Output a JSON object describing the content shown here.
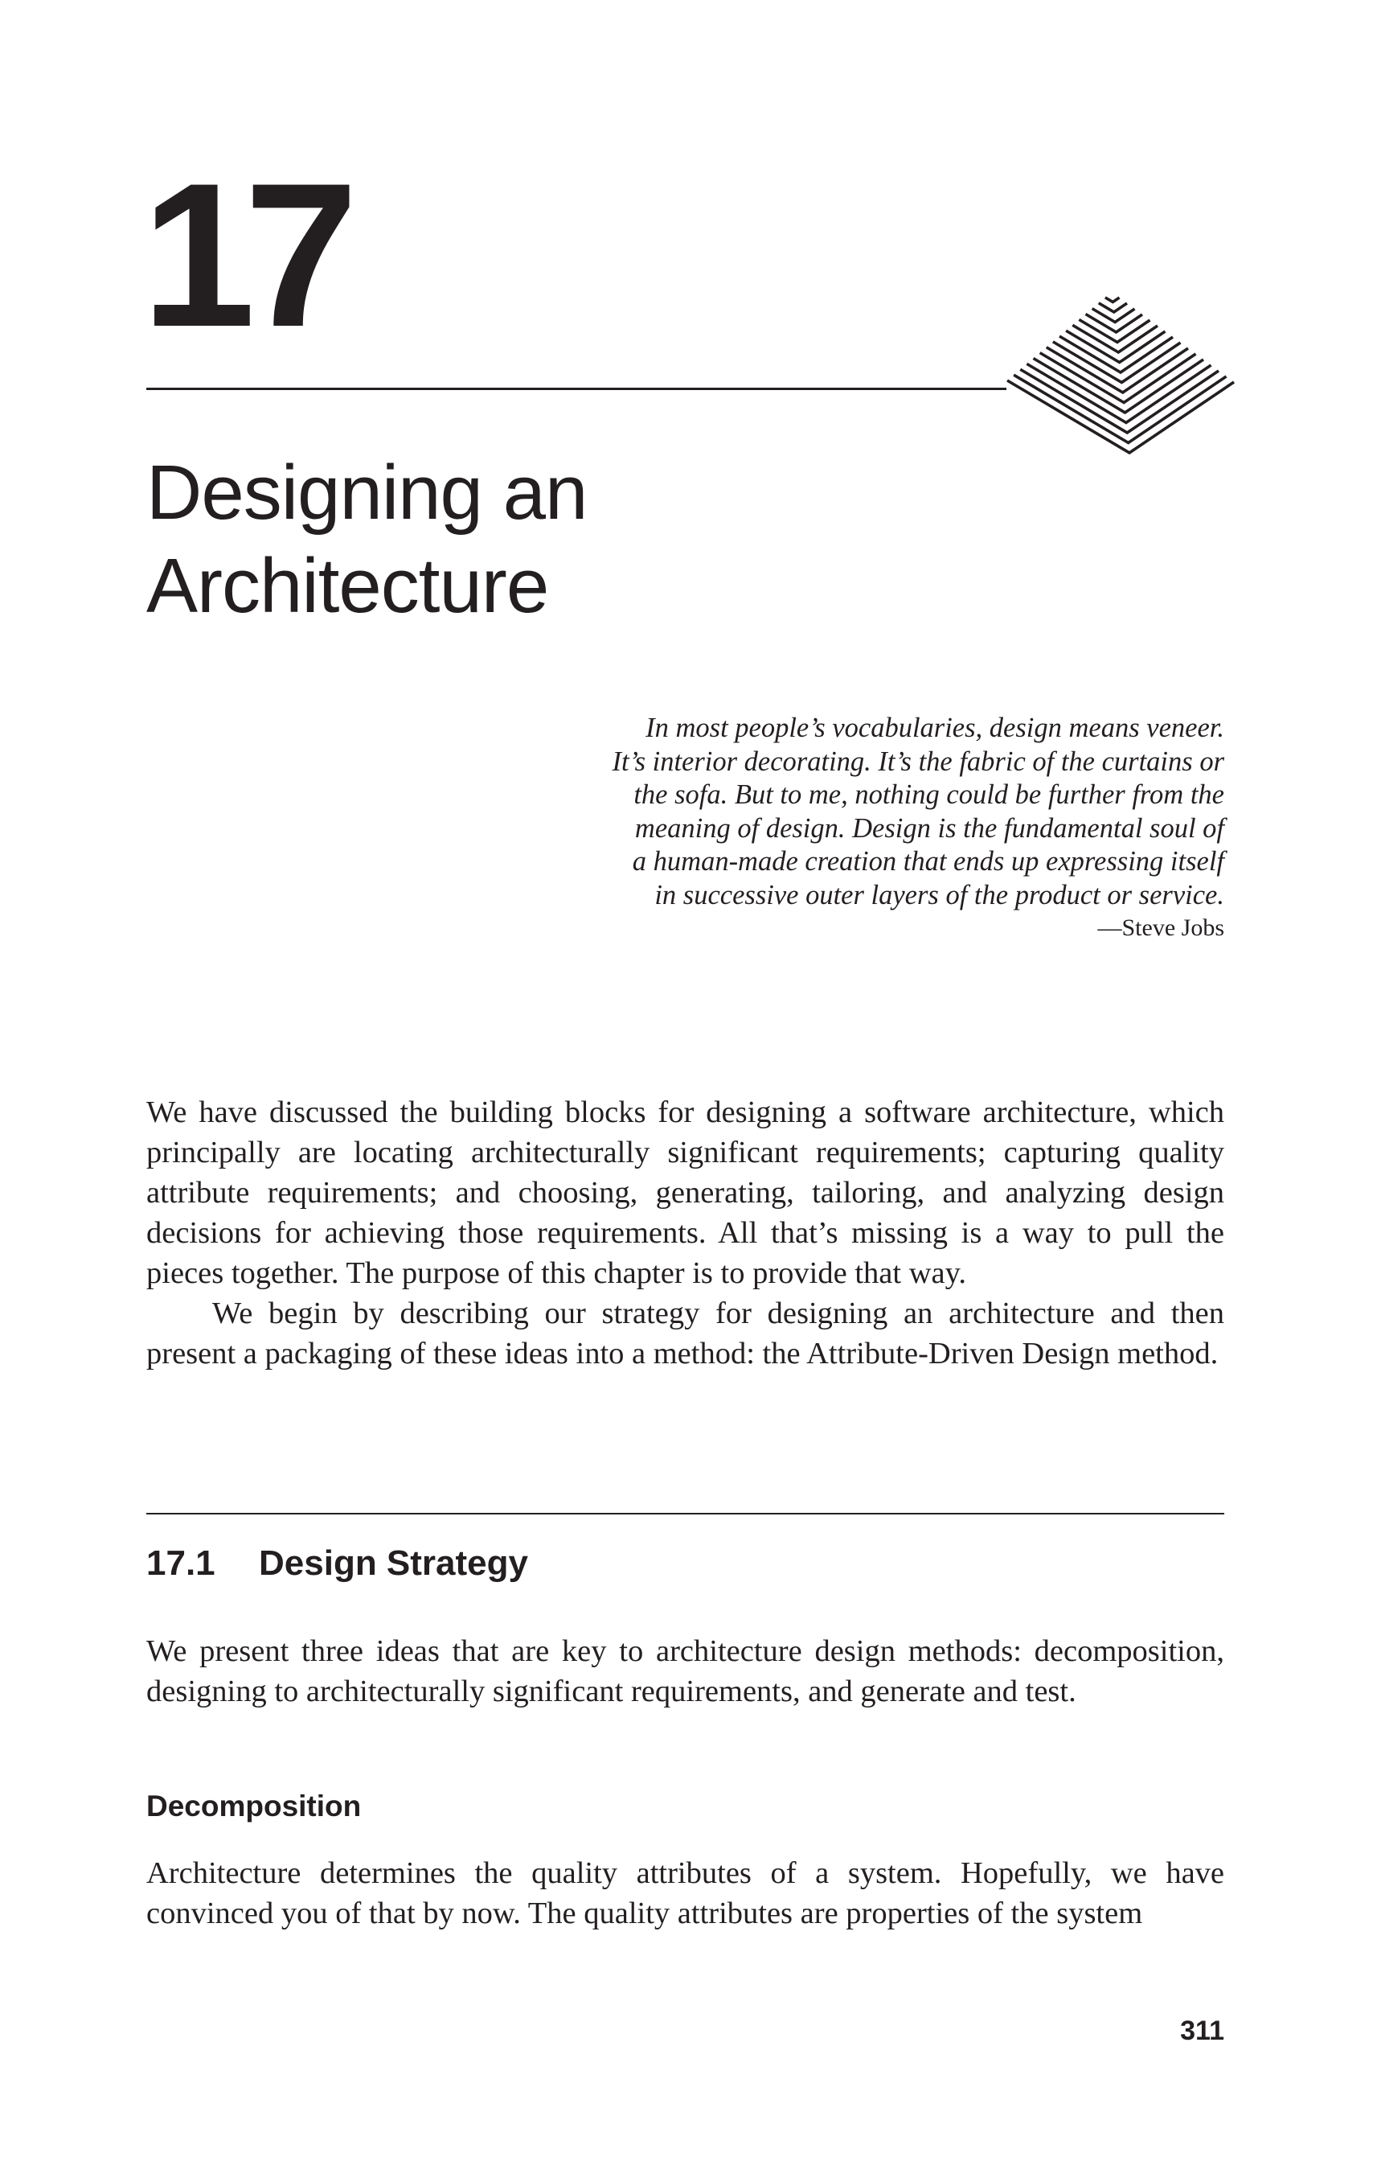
{
  "chapter": {
    "number": "17",
    "title_lines": [
      "Designing an",
      "Architecture"
    ]
  },
  "epigraph": {
    "lines": [
      "In most people’s vocabularies, design means veneer.",
      "It’s interior decorating. It’s the fabric of the curtains or",
      "the sofa. But to me, nothing could be further from the",
      "meaning of design. Design is the fundamental soul of",
      "a human-made creation that ends up expressing itself",
      "in successive outer layers of the product or service."
    ],
    "attribution": "—Steve Jobs"
  },
  "intro": {
    "paragraphs": [
      "We have discussed the building blocks for designing a software architecture, which principally are locating architecturally significant requirements; capturing quality attribute requirements; and choosing, generating, tailoring, and analyzing design decisions for achieving those requirements. All that’s missing is a way to pull the pieces together. The purpose of this chapter is to provide that way.",
      "We begin by describing our strategy for designing an architecture and then present a packaging of these ideas into a method: the Attribute-Driven Design method."
    ]
  },
  "section": {
    "number": "17.1",
    "title": "Design Strategy",
    "paragraph": "We present three ideas that are key to architecture design methods: decomposi­tion, designing to architecturally significant requirements, and generate and test."
  },
  "subsection": {
    "title": "Decomposition",
    "paragraph": "Architecture determines the quality attributes of a system. Hopefully, we have convinced you of that by now. The quality attributes are properties of the system"
  },
  "footer": {
    "page_number": "311"
  }
}
